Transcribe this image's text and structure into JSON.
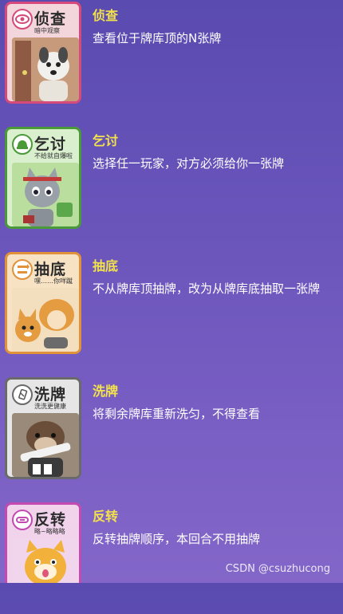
{
  "cards": [
    {
      "name": "侦查",
      "card_label": "侦查",
      "card_sub": "暗中观察",
      "description": "查看位于牌库顶的N张牌",
      "icon": "eye-icon",
      "theme": {
        "border": "#d54a7a",
        "bg": "#f3d6dc",
        "art": "#9a6a55",
        "badge": "#d54a7a"
      }
    },
    {
      "name": "乞讨",
      "card_label": "乞讨",
      "card_sub": "不给就自爆啦",
      "description": "选择任一玩家，对方必须给你一张牌",
      "icon": "hand-icon",
      "theme": {
        "border": "#4a9a3a",
        "bg": "#d9efce",
        "art": "#4e8f3e",
        "badge": "#4a9a3a"
      }
    },
    {
      "name": "抽底",
      "card_label": "抽底",
      "card_sub": "嘿……你咩蹴",
      "description": "不从牌库顶抽牌，改为从牌库底抽取一张牌",
      "icon": "swap-icon",
      "theme": {
        "border": "#e0913a",
        "bg": "#f7e3c4",
        "art": "#c98b45",
        "badge": "#e0913a"
      }
    },
    {
      "name": "洗牌",
      "card_label": "洗牌",
      "card_sub": "洗洗更健康",
      "description": "将剩余牌库重新洗匀，不得查看",
      "icon": "shuffle-icon",
      "theme": {
        "border": "#6a6a6a",
        "bg": "#e6e6e6",
        "art": "#5d4a3c",
        "badge": "#6a6a6a"
      }
    },
    {
      "name": "反转",
      "card_label": "反转",
      "card_sub": "略~略略略",
      "description": "反转抽牌顺序，本回合不用抽牌",
      "icon": "reverse-icon",
      "theme": {
        "border": "#c34ab0",
        "bg": "#f1d4ec",
        "art": "#e9b040",
        "badge": "#c34ab0"
      }
    }
  ],
  "watermark": "CSDN @csuzhucong"
}
